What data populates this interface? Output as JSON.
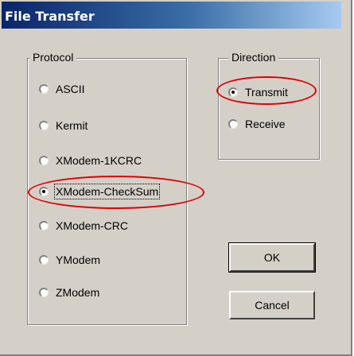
{
  "window": {
    "title": "File Transfer"
  },
  "protocol": {
    "legend": "Protocol",
    "options": [
      {
        "label": "ASCII",
        "selected": false
      },
      {
        "label": "Kermit",
        "selected": false
      },
      {
        "label": "XModem-1KCRC",
        "selected": false
      },
      {
        "label": "XModem-CheckSum",
        "selected": true
      },
      {
        "label": "XModem-CRC",
        "selected": false
      },
      {
        "label": "YModem",
        "selected": false
      },
      {
        "label": "ZModem",
        "selected": false
      }
    ]
  },
  "direction": {
    "legend": "Direction",
    "options": [
      {
        "label": "Transmit",
        "selected": true
      },
      {
        "label": "Receive",
        "selected": false
      }
    ]
  },
  "buttons": {
    "ok": "OK",
    "cancel": "Cancel"
  },
  "annotation": {
    "color": "#e00000"
  }
}
